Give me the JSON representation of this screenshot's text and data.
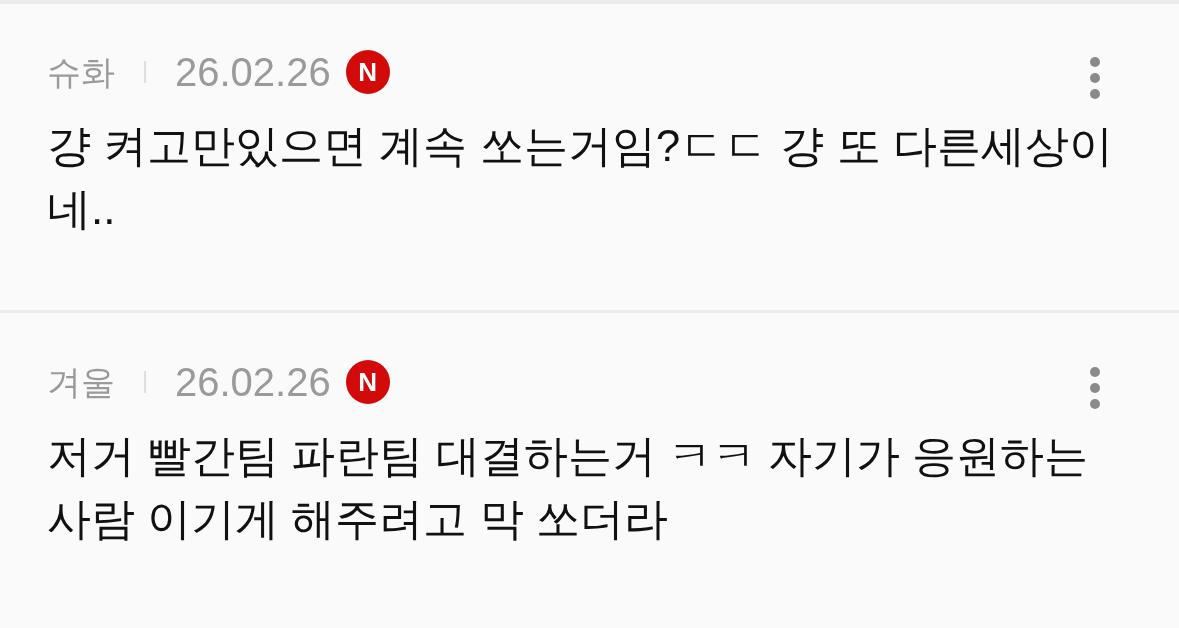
{
  "comments": [
    {
      "author": "슈화",
      "date": "26.02.26",
      "badge": "N",
      "text": "걍 켜고만있으면 계속 쏘는거임?ㄷㄷ 걍 또 다른세상이네.."
    },
    {
      "author": "겨울",
      "date": "26.02.26",
      "badge": "N",
      "text": "저거 빨간팀 파란팀 대결하는거 ㅋㅋ 자기가 응원하는 사람 이기게 해주려고 막 쏘더라"
    }
  ]
}
